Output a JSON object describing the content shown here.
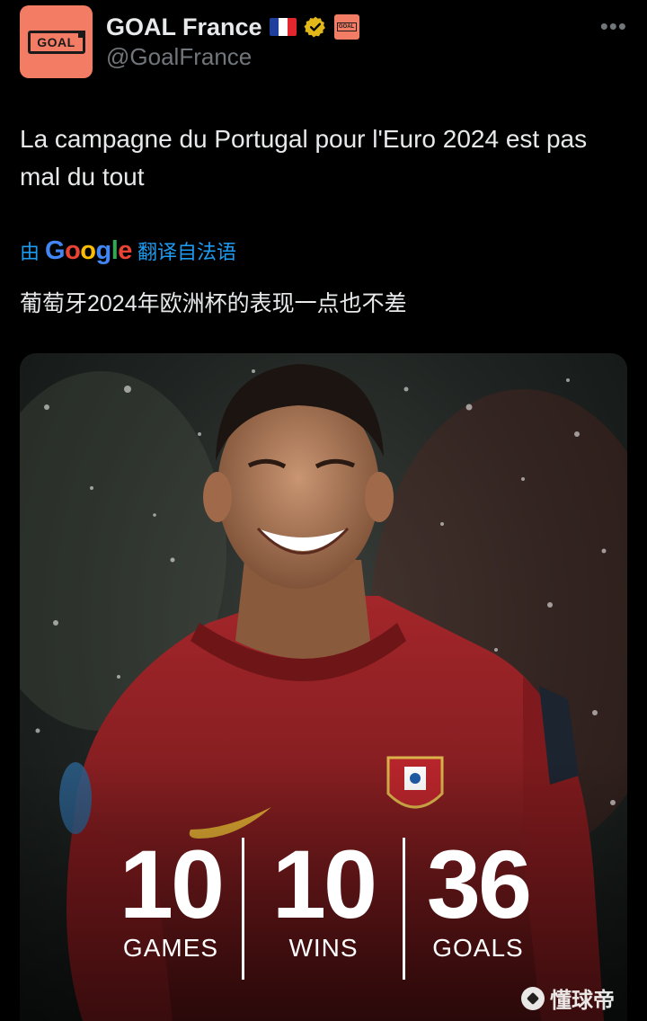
{
  "header": {
    "display_name": "GOAL France",
    "handle": "@GoalFrance",
    "avatar_text": "GOAL",
    "more_label": "•••"
  },
  "tweet": {
    "text": "La campagne du Portugal pour l'Euro 2024 est pas mal du tout",
    "translate_prefix": "由",
    "translate_brand": "Google",
    "translate_suffix": "翻译自法语",
    "translated_text": "葡萄牙2024年欧洲杯的表现一点也不差"
  },
  "media": {
    "stats": [
      {
        "value": "10",
        "label": "GAMES"
      },
      {
        "value": "10",
        "label": "WINS"
      },
      {
        "value": "36",
        "label": "GOALS"
      }
    ],
    "watermark": "懂球帝"
  },
  "colors": {
    "background": "#000000",
    "text": "#e7e9ea",
    "secondary": "#71767b",
    "link": "#1d9bf0",
    "brand": "#f37c64",
    "verified": "#e2b719",
    "jersey": "#8f1d1f"
  },
  "icons": [
    "avatar-logo",
    "france-flag-icon",
    "verified-badge-icon",
    "affiliate-badge-icon",
    "more-icon",
    "watermark-icon"
  ]
}
